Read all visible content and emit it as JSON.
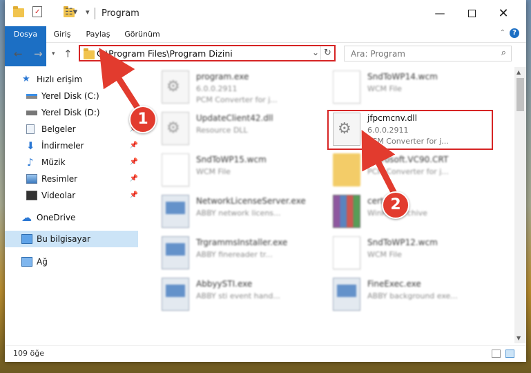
{
  "window": {
    "title": "Program",
    "minimize_icon": "minimize-icon",
    "maximize_icon": "maximize-icon",
    "close_icon": "close-icon"
  },
  "ribbon": {
    "tabs": [
      "Dosya",
      "Giriş",
      "Paylaş",
      "Görünüm"
    ],
    "help": "?"
  },
  "nav": {
    "address": "C:\\Program Files\\Program Dizini",
    "search_placeholder": "Ara: Program"
  },
  "sidebar": {
    "items": [
      {
        "label": "Hızlı erişim",
        "icon": "star-icon",
        "pinned": false
      },
      {
        "label": "Yerel Disk (C:)",
        "icon": "drive-icon",
        "pinned": true
      },
      {
        "label": "Yerel Disk (D:)",
        "icon": "drive-icon",
        "pinned": true
      },
      {
        "label": "Belgeler",
        "icon": "documents-icon",
        "pinned": true
      },
      {
        "label": "İndirmeler",
        "icon": "download-icon",
        "pinned": true
      },
      {
        "label": "Müzik",
        "icon": "music-icon",
        "pinned": true
      },
      {
        "label": "Resimler",
        "icon": "pictures-icon",
        "pinned": true
      },
      {
        "label": "Videolar",
        "icon": "videos-icon",
        "pinned": true
      },
      {
        "label": "OneDrive",
        "icon": "cloud-icon",
        "pinned": false
      },
      {
        "label": "Bu bilgisayar",
        "icon": "computer-icon",
        "pinned": false,
        "selected": true
      },
      {
        "label": "Ağ",
        "icon": "network-icon",
        "pinned": false
      }
    ]
  },
  "files": [
    {
      "name": "program.exe",
      "line2": "6.0.0.2911",
      "line3": "PCM Converter for j...",
      "icon": "gear-file-icon"
    },
    {
      "name": "SndToWP14.wcm",
      "line2": "WCM File",
      "line3": "",
      "icon": "document-icon"
    },
    {
      "name": "UpdateClient42.dll",
      "line2": "Resource DLL",
      "line3": "",
      "icon": "gear-file-icon"
    },
    {
      "name": "jfpcmcnv.dll",
      "line2": "6.0.0.2911",
      "line3": "PCM Converter for j...",
      "icon": "gear-file-icon",
      "highlighted": true
    },
    {
      "name": "SndToWP15.wcm",
      "line2": "WCM File",
      "line3": "",
      "icon": "document-icon"
    },
    {
      "name": "Microsoft.VC90.CRT",
      "line2": "",
      "line3": "PCM Converter for j...",
      "icon": "folder-icon"
    },
    {
      "name": "NetworkLicenseServer.exe",
      "line2": "ABBY network licens...",
      "line3": "",
      "icon": "app-icon"
    },
    {
      "name": "cert.cab",
      "line2": "WinRAR archive",
      "line3": "",
      "icon": "archive-icon"
    },
    {
      "name": "TrgrammsInstaller.exe",
      "line2": "ABBY finereader tr...",
      "line3": "",
      "icon": "app-icon"
    },
    {
      "name": "SndToWP12.wcm",
      "line2": "WCM File",
      "line3": "",
      "icon": "document-icon"
    },
    {
      "name": "AbbyySTI.exe",
      "line2": "ABBY sti event hand...",
      "line3": "",
      "icon": "app-icon"
    },
    {
      "name": "FineExec.exe",
      "line2": "ABBY background exe...",
      "line3": "",
      "icon": "app-icon"
    }
  ],
  "status": {
    "count": "109 öğe"
  },
  "annotations": {
    "step1": "1",
    "step2": "2",
    "accent": "#e23b2e"
  }
}
